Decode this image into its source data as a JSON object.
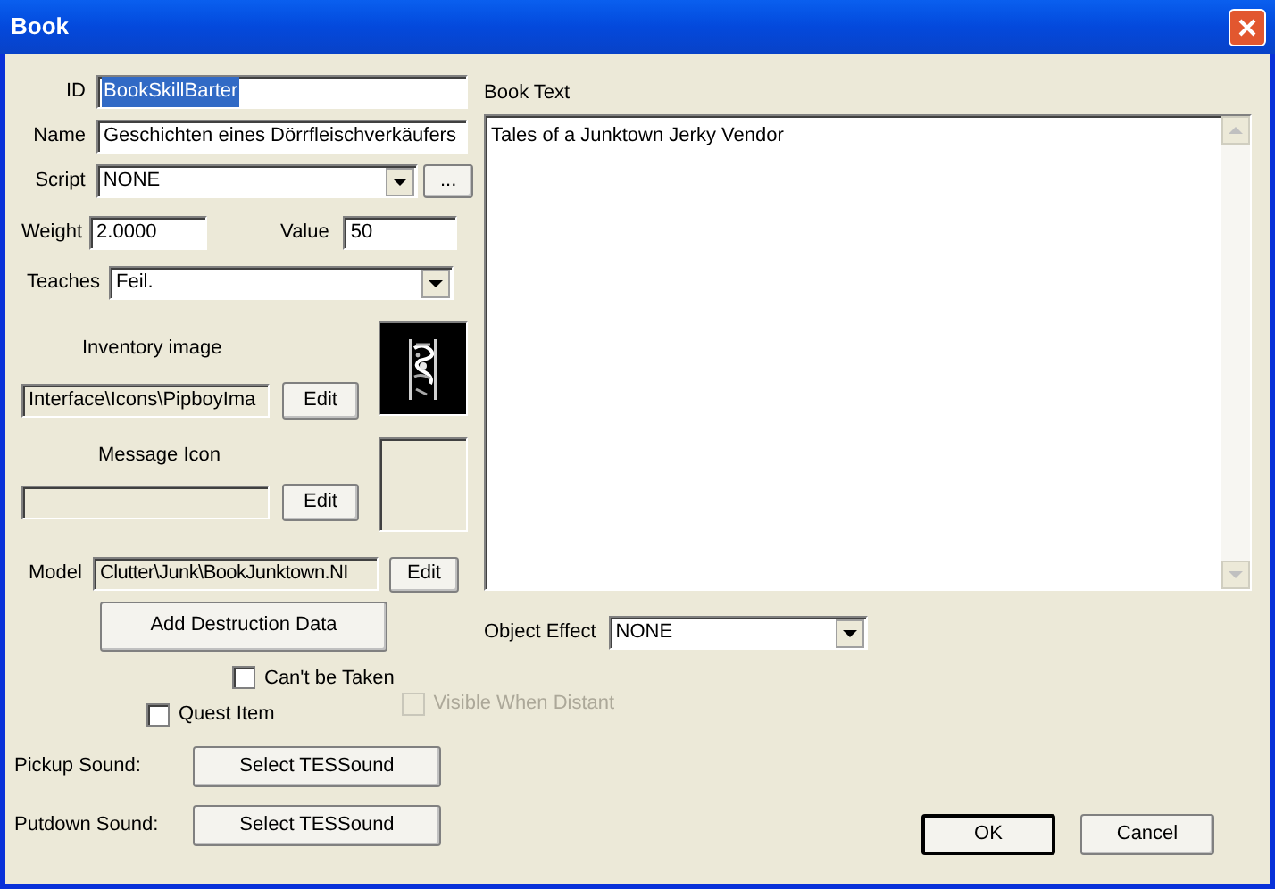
{
  "window": {
    "title": "Book"
  },
  "id_field": {
    "label": "ID",
    "value": "BookSkillBarter",
    "selected": true
  },
  "name_field": {
    "label": "Name",
    "value": "Geschichten eines Dörrfleischverkäufers"
  },
  "script": {
    "label": "Script",
    "value": "NONE",
    "button": "..."
  },
  "weight": {
    "label": "Weight",
    "value": "2.0000"
  },
  "value_field": {
    "label": "Value",
    "value": "50"
  },
  "teaches": {
    "label": "Teaches",
    "value": "Feil."
  },
  "inventory_image": {
    "label": "Inventory image",
    "path": "Interface\\Icons\\PipboyIma",
    "button": "Edit",
    "has_image": true
  },
  "message_icon": {
    "label": "Message Icon",
    "button": "Edit",
    "has_image": false
  },
  "model": {
    "label": "Model",
    "value": "Clutter\\Junk\\BookJunktown.NI",
    "button": "Edit"
  },
  "book_text": {
    "label": "Book Text",
    "value": "Tales of a Junktown Jerky Vendor"
  },
  "destruction_button": "Add Destruction Data",
  "object_effect": {
    "label": "Object Effect",
    "value": "NONE"
  },
  "checkboxes": [
    {
      "label": "Can't be Taken",
      "checked": false,
      "disabled": false
    },
    {
      "label": "Quest Item",
      "checked": false,
      "disabled": false
    },
    {
      "label": "Visible When Distant",
      "checked": false,
      "disabled": true
    }
  ],
  "sounds": [
    {
      "label": "Pickup Sound:",
      "button": "Select TESSound"
    },
    {
      "label": "Putdown Sound:",
      "button": "Select TESSound"
    }
  ],
  "buttons": [
    {
      "label": "OK",
      "default": true
    },
    {
      "label": "Cancel",
      "default": false
    }
  ]
}
